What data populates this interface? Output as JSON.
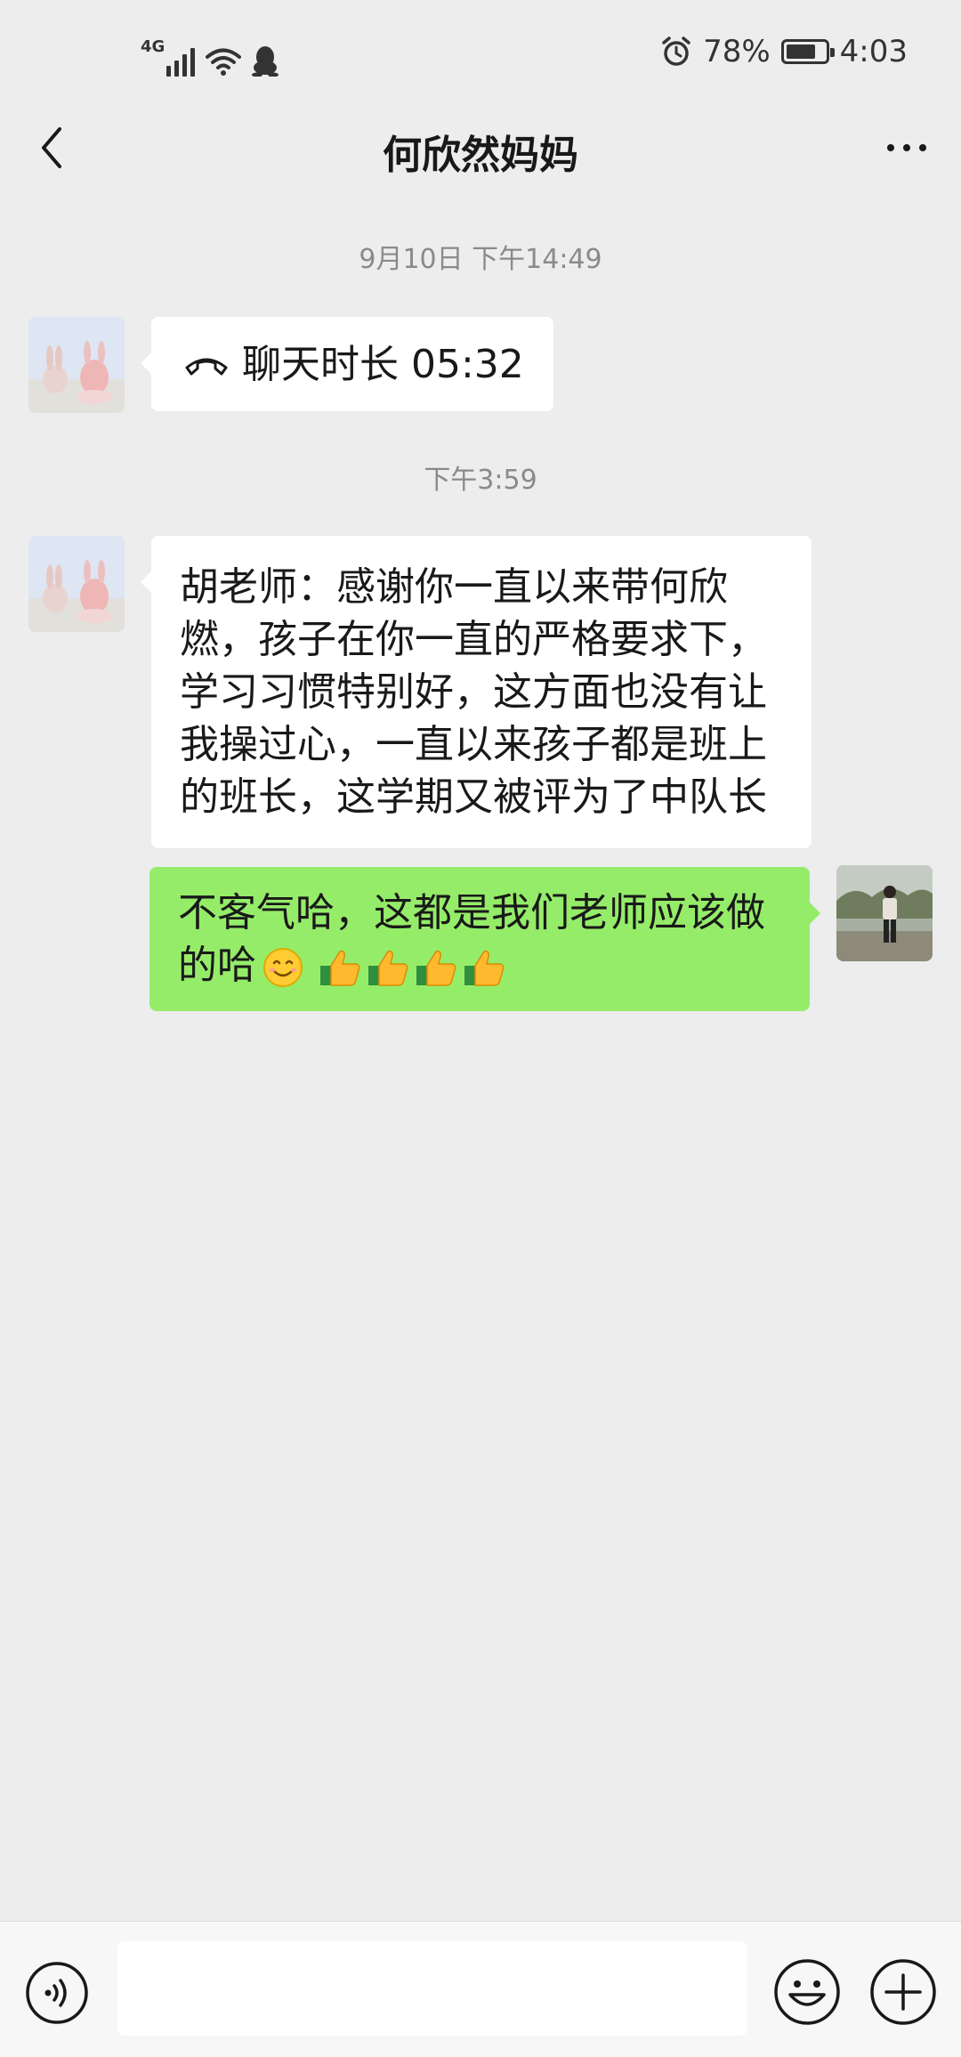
{
  "status_bar": {
    "network": "4G",
    "battery": "78%",
    "battery_level": 0.78,
    "time": "4:03",
    "icons": [
      "signal-icon",
      "wifi-icon",
      "qq-icon",
      "alarm-icon",
      "battery-icon"
    ]
  },
  "header": {
    "title": "何欣然妈妈",
    "back_icon": "chevron-left-icon",
    "more_icon": "more-icon"
  },
  "messages": [
    {
      "type": "timestamp",
      "text": "9月10日 下午14:49"
    },
    {
      "type": "call",
      "from": "other",
      "icon": "phone-hangup-icon",
      "text": "聊天时长 05:32"
    },
    {
      "type": "timestamp",
      "text": "下午3:59"
    },
    {
      "type": "text",
      "from": "other",
      "text": "胡老师：感谢你一直以来带何欣燃，孩子在你一直的严格要求下，学习习惯特别好，这方面也没有让我操过心，一直以来孩子都是班上的班长，这学期又被评为了中队长"
    },
    {
      "type": "text",
      "from": "self",
      "text": "不客气哈，这都是我们老师应该做的哈",
      "emojis": [
        "smile-emoji",
        "thumbs-up-emoji",
        "thumbs-up-emoji",
        "thumbs-up-emoji",
        "thumbs-up-emoji"
      ]
    }
  ],
  "input_bar": {
    "value": "",
    "icons": [
      "voice-icon",
      "emoji-icon",
      "plus-icon"
    ]
  },
  "colors": {
    "background": "#ededed",
    "bubble_self": "#95ec69",
    "bubble_other": "#ffffff",
    "timestamp_text": "#8a8a8a"
  }
}
